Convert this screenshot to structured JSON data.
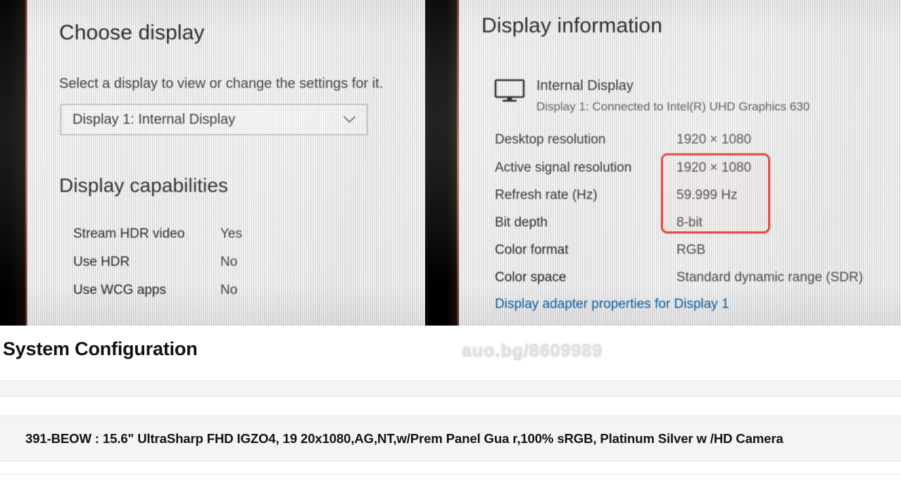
{
  "photo": {
    "left_panel": {
      "title": "Choose display",
      "subtitle": "Select a display to view or change the settings for it.",
      "display_select": {
        "selected": "Display 1: Internal Display",
        "chevron_icon": "chevron-down-icon"
      },
      "capabilities_title": "Display capabilities",
      "capabilities": [
        {
          "label": "Stream HDR video",
          "value": "Yes"
        },
        {
          "label": "Use HDR",
          "value": "No"
        },
        {
          "label": "Use WCG apps",
          "value": "No"
        }
      ]
    },
    "right_panel": {
      "title": "Display information",
      "device": {
        "icon": "monitor-icon",
        "name": "Internal Display",
        "connection": "Display 1: Connected to Intel(R) UHD Graphics 630"
      },
      "rows": [
        {
          "label": "Desktop resolution",
          "value": "1920 × 1080"
        },
        {
          "label": "Active signal resolution",
          "value": "1920 × 1080"
        },
        {
          "label": "Refresh rate (Hz)",
          "value": "59.999 Hz"
        },
        {
          "label": "Bit depth",
          "value": "8-bit"
        },
        {
          "label": "Color format",
          "value": "RGB"
        },
        {
          "label": "Color space",
          "value": "Standard dynamic range (SDR)"
        }
      ],
      "adapter_link": "Display adapter properties for Display 1",
      "highlight": {
        "color": "#e0473f",
        "covers": [
          "Active signal resolution",
          "Refresh rate (Hz)",
          "Bit depth"
        ]
      }
    }
  },
  "page": {
    "heading": "System Configuration",
    "watermark": "auo.bg/8609989",
    "spec_row": "391-BEOW : 15.6\" UltraSharp FHD IGZO4, 19 20x1080,AG,NT,w/Prem Panel Gua r,100% sRGB, Platinum Silver w /HD Camera"
  },
  "colors": {
    "link": "#0b5fa5",
    "highlight_red": "#e0473f",
    "row_background": "#f4f4f4",
    "bezel": "#000000"
  }
}
